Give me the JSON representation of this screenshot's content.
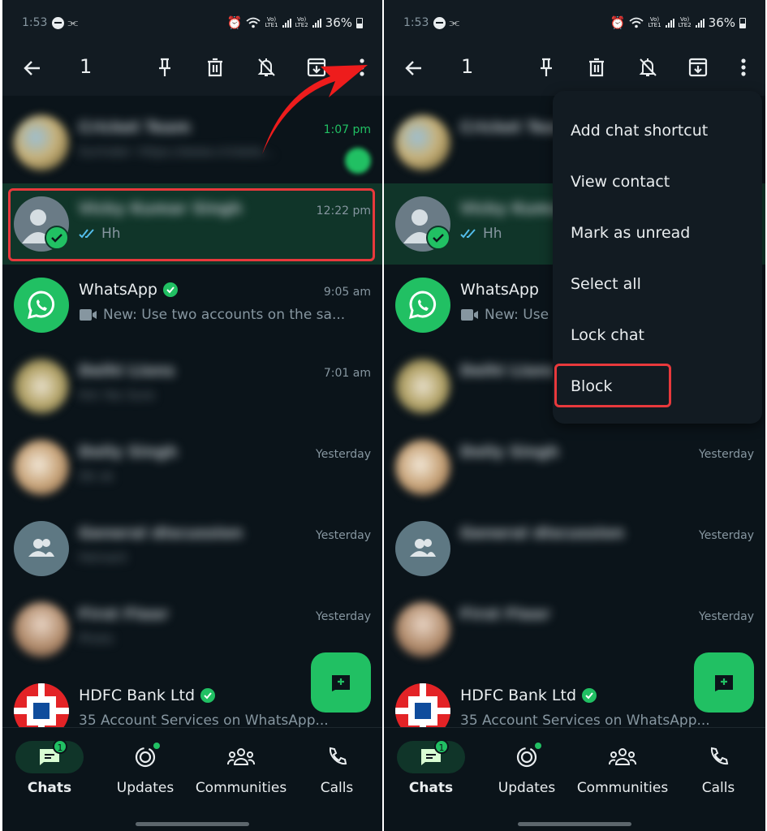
{
  "status_bar": {
    "time": "1:53",
    "link_glyph": "⫘",
    "network1_top": "Vo)",
    "network1_bottom": "LTE1",
    "network2_top": "Vo)",
    "network2_bottom": "LTE2",
    "battery": "36%"
  },
  "toolbar": {
    "selected_count": "1",
    "icons": [
      "back-arrow-icon",
      "pin-icon",
      "delete-icon",
      "mute-icon",
      "archive-icon",
      "more-options-icon"
    ]
  },
  "chats": [
    {
      "name": "Cricket Team",
      "preview": "Surinder: https://www.crickete...",
      "time": "1:07 pm",
      "time_green": true,
      "blurred": true,
      "avatar": "group-photo"
    },
    {
      "name": "Vicky Kumar Singh",
      "preview": "Hh",
      "time": "12:22 pm",
      "blurred_name": true,
      "selected": true,
      "avatar": "default-person"
    },
    {
      "name": "WhatsApp",
      "preview": "New: Use two accounts on the sa...",
      "time": "9:05 am",
      "verified": true,
      "avatar": "whatsapp-logo"
    },
    {
      "name": "Delhi Lions",
      "preview": "Hm Yes Sure",
      "time": "7:01 am",
      "blurred": true,
      "avatar": "photo"
    },
    {
      "name": "Dolly Singh",
      "preview": "Ok ok",
      "time": "Yesterday",
      "blurred": true,
      "avatar": "photo"
    },
    {
      "name": "General discussion",
      "preview": "Hemant",
      "time": "Yesterday",
      "blurred": true,
      "avatar": "group-default"
    },
    {
      "name": "First Floor",
      "preview": "Photo",
      "time": "Yesterday",
      "blurred": true,
      "avatar": "photo"
    },
    {
      "name": "HDFC Bank Ltd",
      "preview": "35 Account Services on WhatsApp...",
      "time": "",
      "verified": true,
      "avatar": "hdfc-logo"
    }
  ],
  "right_chats_visible": [
    {
      "name": "Cricket Team",
      "time": ""
    },
    {
      "name": "Vicky Kumar",
      "preview": "Hh"
    },
    {
      "name": "WhatsApp",
      "preview": "New: Use"
    },
    {
      "name": "Delhi Lions",
      "time": ""
    },
    {
      "name": "Dolly Singh",
      "time": "Yesterday"
    },
    {
      "name": "General discussion",
      "time": "Yesterday"
    },
    {
      "name": "First Floor",
      "time": "Yesterday"
    },
    {
      "name": "HDFC Bank Ltd",
      "preview": "35 Account Services on WhatsApp..."
    }
  ],
  "overflow_menu": {
    "items": [
      "Add chat shortcut",
      "View contact",
      "Mark as unread",
      "Select all",
      "Lock chat",
      "Block"
    ],
    "highlighted": "Block"
  },
  "bottom_nav": {
    "items": [
      {
        "label": "Chats",
        "badge": "1",
        "active": true
      },
      {
        "label": "Updates",
        "dot": true
      },
      {
        "label": "Communities"
      },
      {
        "label": "Calls"
      }
    ]
  },
  "colors": {
    "background": "#0b141a",
    "bar": "#121b22",
    "accent_green": "#21c063",
    "selected_row": "#103529",
    "annotation_red": "#e8393c"
  }
}
